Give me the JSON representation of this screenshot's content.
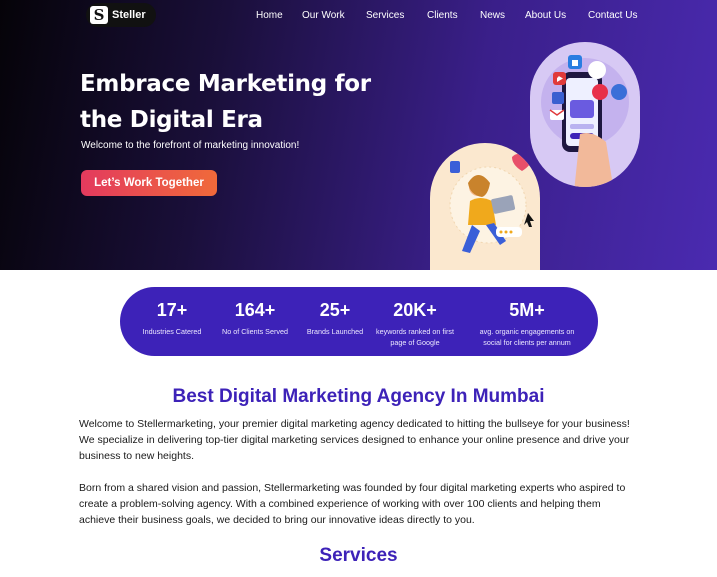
{
  "nav": {
    "logo_text": "Steller",
    "logo_mark": "S",
    "items": [
      {
        "label": "Home"
      },
      {
        "label": "Our Work"
      },
      {
        "label": "Services"
      },
      {
        "label": "Clients"
      },
      {
        "label": "News"
      },
      {
        "label": "About Us"
      },
      {
        "label": "Contact Us"
      }
    ]
  },
  "hero": {
    "title": "Embrace Marketing for the Digital Era",
    "subtitle": "Welcome to the forefront of marketing innovation!",
    "cta_label": "Let’s Work Together",
    "illustrations": [
      "phone-hand-social-icons",
      "girl-with-laptop"
    ]
  },
  "stats": [
    {
      "value": "17+",
      "label": "Industries Catered"
    },
    {
      "value": "164+",
      "label": "No of Clients Served"
    },
    {
      "value": "25+",
      "label": "Brands Launched"
    },
    {
      "value": "20K+",
      "label": "keywords ranked on first page of Google"
    },
    {
      "value": "5M+",
      "label": "avg. organic engagements on social for clients per annum"
    }
  ],
  "about": {
    "heading": "Best Digital Marketing Agency In Mumbai",
    "paragraph_1": "Welcome to Stellermarketing, your premier digital marketing agency dedicated to hitting the bullseye for your business! We specialize in delivering top-tier digital marketing services designed to enhance your online presence and drive your business to new heights.",
    "paragraph_2": "Born from a shared vision and passion, Stellermarketing was founded by four digital marketing experts who aspired to create a problem-solving agency. With a combined experience of working with over 100 clients and helping them achieve their business goals, we decided to bring our innovative ideas directly to you."
  },
  "services": {
    "heading": "Services"
  },
  "colors": {
    "brand_purple": "#3d22b8",
    "cta_start": "#e33a5e",
    "cta_end": "#f06a3a"
  }
}
